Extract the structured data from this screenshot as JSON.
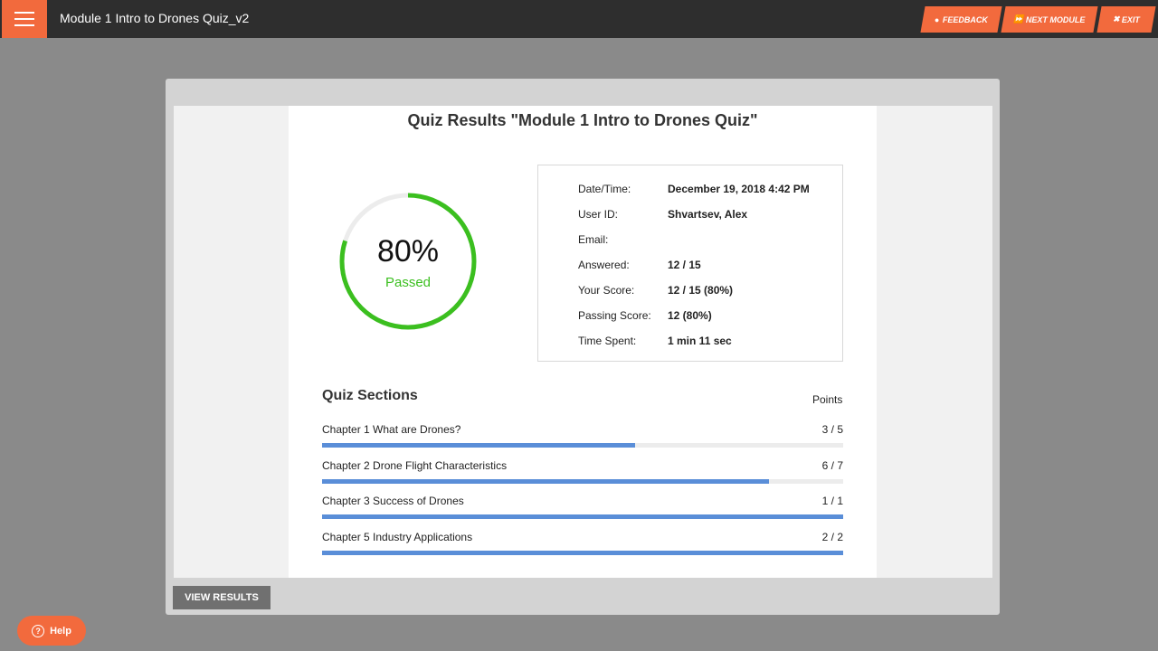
{
  "header": {
    "title": "Module 1 Intro to Drones Quiz_v2",
    "feedback_label": "FEEDBACK",
    "next_label": "NEXT MODULE",
    "exit_label": "EXIT",
    "menu_icon": "hamburger-icon",
    "feedback_icon": "speech-bubble-icon",
    "next_icon": "fast-forward-icon",
    "exit_icon": "close-icon",
    "accent_color": "#f26a3d"
  },
  "results": {
    "title": "Quiz Results \"Module 1 Intro to Drones Quiz\"",
    "score_percent": "80%",
    "score_fraction": 0.8,
    "status": "Passed",
    "status_color": "#3bbf1f",
    "details": [
      {
        "label": "Date/Time:",
        "value": "December 19, 2018 4:42 PM"
      },
      {
        "label": "User ID:",
        "value": "Shvartsev, Alex"
      },
      {
        "label": "Email:",
        "value": ""
      },
      {
        "label": "Answered:",
        "value": "12 / 15"
      },
      {
        "label": "Your Score:",
        "value": "12 / 15 (80%)"
      },
      {
        "label": "Passing Score:",
        "value": "12 (80%)"
      },
      {
        "label": "Time Spent:",
        "value": "1 min 11 sec"
      }
    ]
  },
  "sections": {
    "title": "Quiz Sections",
    "points_header": "Points",
    "items": [
      {
        "name": "Chapter 1 What are Drones?",
        "points": "3 / 5",
        "progress": 0.6
      },
      {
        "name": "Chapter 2 Drone Flight Characteristics",
        "points": "6 / 7",
        "progress": 0.857
      },
      {
        "name": "Chapter 3 Success of Drones",
        "points": "1 / 1",
        "progress": 1.0
      },
      {
        "name": "Chapter 5 Industry Applications",
        "points": "2 / 2",
        "progress": 1.0
      }
    ]
  },
  "footer": {
    "view_results_label": "VIEW RESULTS",
    "help_label": "Help",
    "help_icon": "question-circle-icon"
  }
}
